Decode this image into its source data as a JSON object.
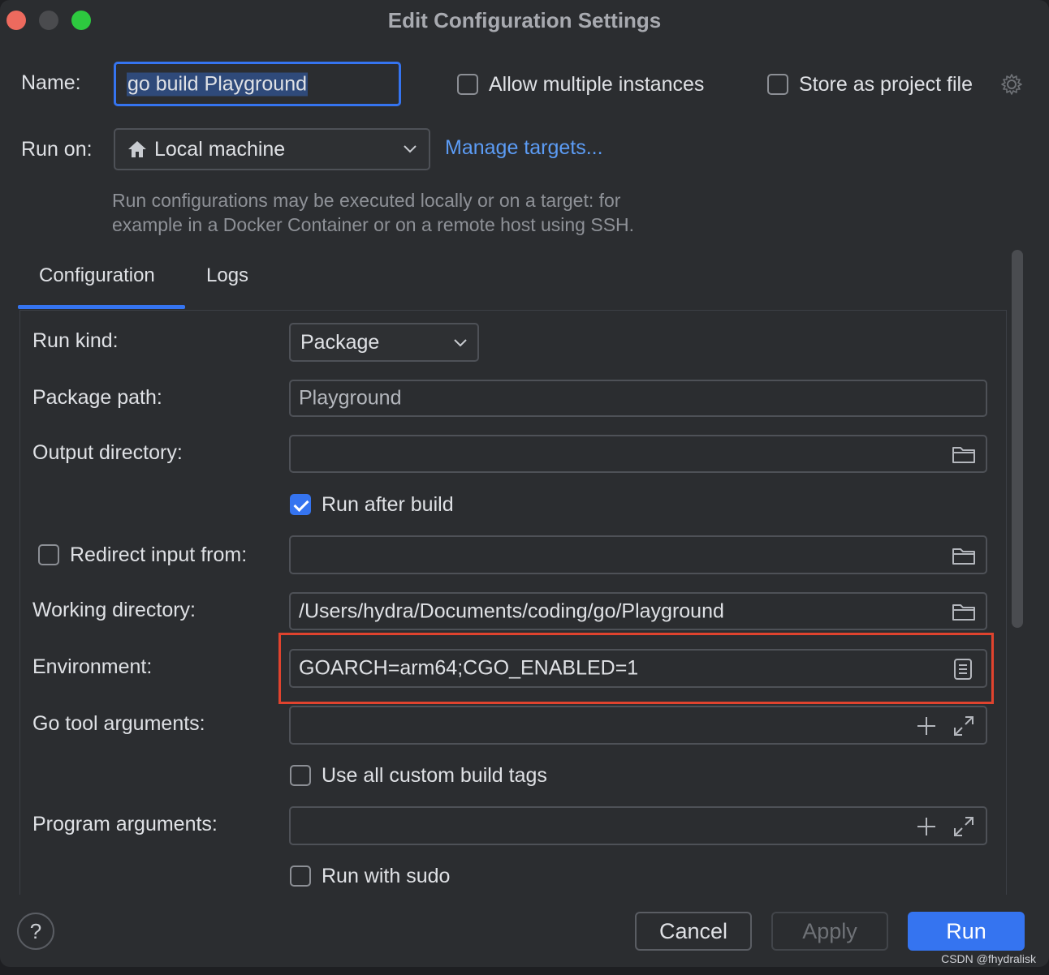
{
  "window": {
    "title": "Edit Configuration Settings"
  },
  "header": {
    "name_label": "Name:",
    "name_value": "go build Playground",
    "allow_multiple_label": "Allow multiple instances",
    "store_project_label": "Store as project file",
    "run_on_label": "Run on:",
    "run_on_value": "Local machine",
    "manage_targets": "Manage targets...",
    "hint_line1": "Run configurations may be executed locally or on a target: for",
    "hint_line2": "example in a Docker Container or on a remote host using SSH."
  },
  "tabs": [
    {
      "label": "Configuration",
      "active": true
    },
    {
      "label": "Logs",
      "active": false
    }
  ],
  "config": {
    "run_kind_label": "Run kind:",
    "run_kind_value": "Package",
    "package_path_label": "Package path:",
    "package_path_value": "Playground",
    "output_dir_label": "Output directory:",
    "output_dir_value": "",
    "run_after_build_label": "Run after build",
    "run_after_build_checked": true,
    "redirect_input_label": "Redirect input from:",
    "redirect_input_value": "",
    "working_dir_label": "Working directory:",
    "working_dir_value": "/Users/hydra/Documents/coding/go/Playground",
    "environment_label": "Environment:",
    "environment_value": "GOARCH=arm64;CGO_ENABLED=1",
    "go_tool_args_label": "Go tool arguments:",
    "use_build_tags_label": "Use all custom build tags",
    "program_args_label": "Program arguments:",
    "run_with_sudo_label": "Run with sudo"
  },
  "footer": {
    "help": "?",
    "cancel": "Cancel",
    "apply": "Apply",
    "run": "Run"
  },
  "watermark": "CSDN @fhydralisk",
  "colors": {
    "accent": "#3574f0",
    "highlight": "#e0432e",
    "background": "#2b2d30"
  }
}
